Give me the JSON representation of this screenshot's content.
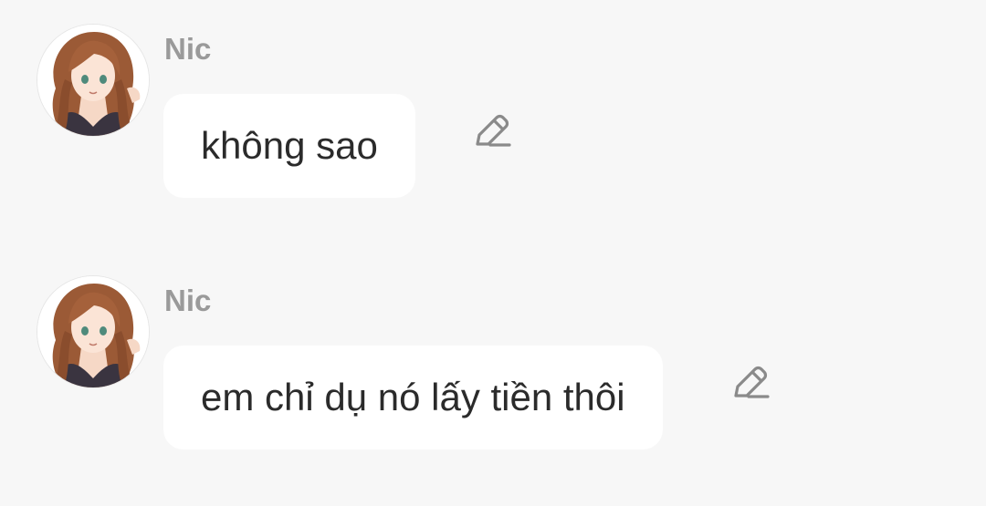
{
  "messages": [
    {
      "sender": "Nic",
      "text": "không sao",
      "avatar_icon": "anime-girl-avatar",
      "action_icon": "pencil-edit-icon"
    },
    {
      "sender": "Nic",
      "text": "em chỉ dụ nó lấy tiền thôi",
      "avatar_icon": "anime-girl-avatar",
      "action_icon": "pencil-edit-icon"
    }
  ],
  "colors": {
    "background": "#f7f7f7",
    "bubble": "#ffffff",
    "sender_name": "#9a9a9a",
    "message_text": "#2b2b2b",
    "icon": "#8a8a8a"
  }
}
